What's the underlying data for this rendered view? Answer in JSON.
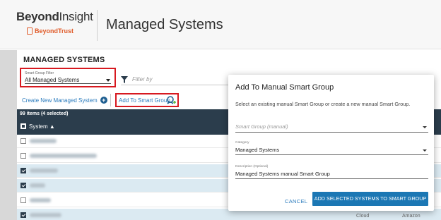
{
  "header": {
    "logo_main_bold": "Beyond",
    "logo_main_rest": "Insight",
    "logo_sub": "BeyondTrust",
    "page_title": "Managed Systems"
  },
  "panel": {
    "title": "MANAGED SYSTEMS",
    "filter": {
      "label": "Smart Group Filter",
      "value": "All Managed Systems"
    },
    "filter_by_placeholder": "Filter by",
    "create_button": "Create New Managed System",
    "add_to_smart_group": "Add To Smart Group",
    "items_count": "99 items (4 selected)",
    "column_system": "System ▲",
    "rows": [
      {
        "selected": false,
        "extra_a": "",
        "extra_b": ""
      },
      {
        "selected": false,
        "extra_a": "",
        "extra_b": ""
      },
      {
        "selected": true,
        "extra_a": "",
        "extra_b": ""
      },
      {
        "selected": true,
        "extra_a": "",
        "extra_b": ""
      },
      {
        "selected": false,
        "extra_a": "",
        "extra_b": ""
      },
      {
        "selected": true,
        "extra_a": "Cloud",
        "extra_b": "Amazon"
      }
    ]
  },
  "modal": {
    "title": "Add To Manual Smart Group",
    "description": "Select an existing manual Smart Group or create a new manual Smart Group.",
    "smart_group_placeholder": "Smart Group (manual)",
    "category_label": "Category",
    "category_value": "Managed Systems",
    "description_label": "Description (Optional)",
    "description_value": "Managed Systems manual Smart Group",
    "cancel_label": "CANCEL",
    "add_label": "ADD SELECTED SYSTEMS TO SMART GROUP"
  },
  "colors": {
    "accent": "#1b77b4",
    "header_dark": "#2b3d4c",
    "highlight_red": "#d71920",
    "selected_row": "#dbeaf2"
  }
}
